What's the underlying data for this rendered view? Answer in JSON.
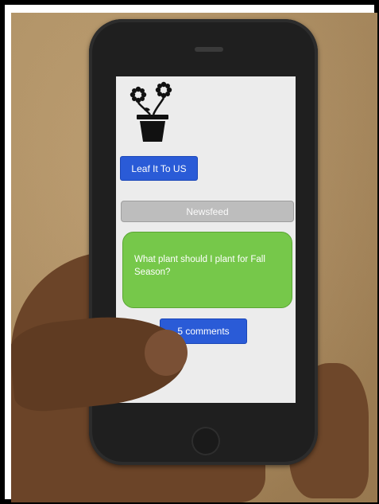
{
  "app": {
    "title_button": "Leaf It To US",
    "logo_icon": "flower-pot-icon"
  },
  "newsfeed": {
    "header": "Newsfeed",
    "post": {
      "text": "What plant should I plant for Fall Season?",
      "comments_button": "5 comments"
    }
  },
  "colors": {
    "primary_button": "#2a5bd7",
    "post_card": "#76c84a",
    "section_header": "#bdbdbd",
    "screen_bg": "#ececec"
  }
}
